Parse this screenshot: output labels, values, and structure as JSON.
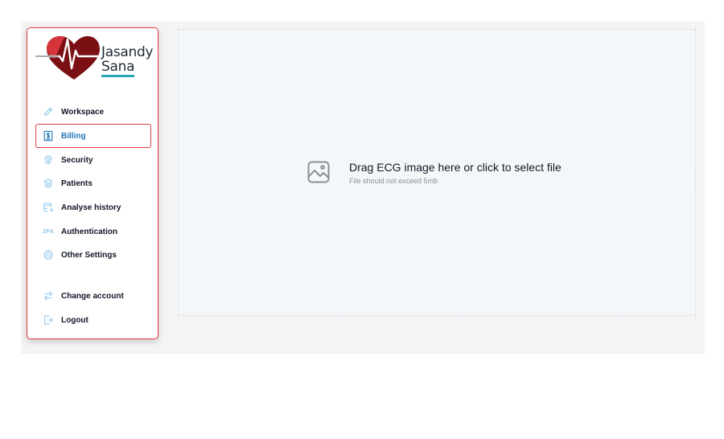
{
  "brand": {
    "name_line1": "Jasandy",
    "name_line2": "Sana",
    "colors": {
      "heart_dark": "#7a0f14",
      "heart_light": "#d7333b",
      "underline": "#2aa5b2"
    }
  },
  "sidebar": {
    "items": [
      {
        "label": "Workspace",
        "icon": "pencil-icon"
      },
      {
        "label": "Billing",
        "icon": "receipt-dollar-icon",
        "active": true
      },
      {
        "label": "Security",
        "icon": "fingerprint-icon"
      },
      {
        "label": "Patients",
        "icon": "users-icon"
      },
      {
        "label": "Analyse history",
        "icon": "database-icon"
      },
      {
        "label": "Authentication",
        "icon": "two-factor-icon",
        "glyph": "2FA"
      },
      {
        "label": "Other Settings",
        "icon": "gear-icon"
      },
      {
        "label": "Change account",
        "icon": "swap-arrows-icon"
      },
      {
        "label": "Logout",
        "icon": "logout-icon"
      }
    ]
  },
  "upload": {
    "title": "Drag ECG image here or click to select file",
    "subtitle": "File should not exceed 5mb",
    "icon": "image-icon"
  },
  "colors": {
    "accent": "#1f77b4",
    "highlight_border": "#e23a3a",
    "icon_light": "#8ec7ef"
  }
}
